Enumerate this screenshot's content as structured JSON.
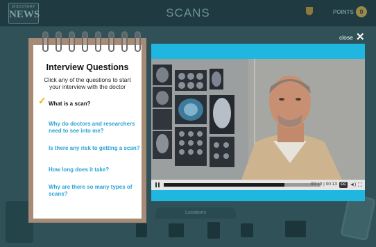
{
  "app": {
    "logo_small": "DISCOVERY",
    "logo_big": "NEWS",
    "title": "SCANS",
    "points_label": "POINTS",
    "points_value": "0"
  },
  "background": {
    "locations_tab": "Locations"
  },
  "notepad": {
    "title": "Interview Questions",
    "instructions": "Click any of the questions to start your interview with the doctor",
    "questions": [
      {
        "label": "What is a scan?",
        "answered": true
      },
      {
        "label": "Why do doctors and researchers need to see into me?",
        "answered": false
      },
      {
        "label": "Is there any risk to getting a scan?",
        "answered": false
      },
      {
        "label": "How long does it take?",
        "answered": false
      },
      {
        "label": "Why are there so many types of scans?",
        "answered": false
      }
    ]
  },
  "player": {
    "close_label": "close",
    "current_time": "00:10",
    "duration": "00:13",
    "progress": 0.77,
    "cc_label": "CC",
    "colors": {
      "frame": "#1fb6e0",
      "accent_check": "#f2b20e",
      "question_link": "#2aa3d4"
    }
  }
}
